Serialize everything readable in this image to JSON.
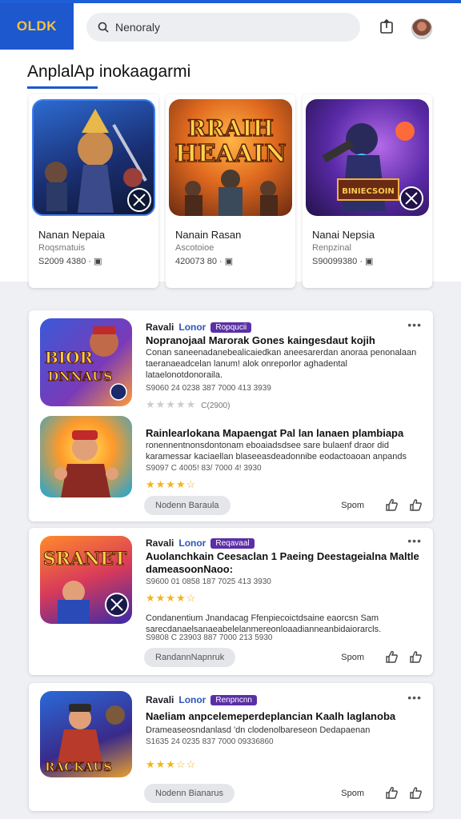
{
  "header": {
    "logo": "OLDK",
    "search_value": "Nenoraly"
  },
  "featured": {
    "title": "AnplalAp inokaagarmi",
    "items": [
      {
        "name": "Nanan Nepaia",
        "sub": "Roqsmatuis",
        "meta": "S2009 4380 · ▣"
      },
      {
        "name": "Nanain Rasan",
        "sub": "Ascotoioe",
        "meta": "420073 80 · ▣"
      },
      {
        "name": "Nanai Nepsia",
        "sub": "Renpzinal",
        "meta": "S90099380 · ▣"
      }
    ]
  },
  "list": {
    "card1": {
      "brand": "Ravali",
      "sub": "Lonor",
      "pill": "Ropqucii",
      "title": "Nopranojaal Marorak Gones kaingesdaut kojih",
      "desc": "Conan saneenadanebealicaiedkan aneesarerdan anoraa penonalaan taeranaeadcelan lanum! alok onreporlor aghadental lataelonotdonoraila.",
      "meta": "S9060 24 0238 387 7000 413 3939",
      "stars": "★★★★★",
      "rating_count": "C(2900)",
      "title2": "Rainlearlokana Mapaengat Pal lan lanaen plambiapa",
      "desc2": "ronennentnonsdontonam eboaiadsdsee sare bulaenf draor did karamessar kaciaellan blaseeasdeadonnibe eodactoaoan anpands",
      "meta2": "S9097 C 4005! 83/ 7000 4! 3930",
      "stars2": "★★★★☆",
      "button": "Nodenn Baraula",
      "action": "Spom"
    },
    "card2": {
      "brand": "Ravali",
      "sub": "Lonor",
      "pill": "Reqavaal",
      "title": "Auolanchkain Ceesaclan 1 Paeing Deestageialna Maltle dameasoonNaoo:",
      "meta": "S9600 01 0858 187 7025 413 3930",
      "stars": "★★★★☆",
      "desc2": "Condanentium Jnandacag Ffenpiecoictdsaine eaorcsn Sam sarecdanaelsanaeabelelanmereonloaadianneanbidaiorarcls.",
      "meta2": "S9808 C 23903 887 7000 213 5930",
      "button": "RandannNapnruk",
      "action": "Spom"
    },
    "card3": {
      "brand": "Ravali",
      "sub": "Lonor",
      "pill": "Renpncnn",
      "title": "Naeliam anpcelemeperdeplancian Kaalh laglanoba",
      "desc": "Drameaseosndanlasd 'dn clodenolbareseon Dedapaenan",
      "meta": "S1635 24 0235 837 7000 09336860",
      "stars": "★★★☆☆",
      "button": "Nodenn Bianarus",
      "action": "Spom"
    }
  },
  "colors": {
    "brand_blue": "#1d58cf",
    "star": "#f2b51b",
    "pill_purple": "#5b2fa6"
  }
}
